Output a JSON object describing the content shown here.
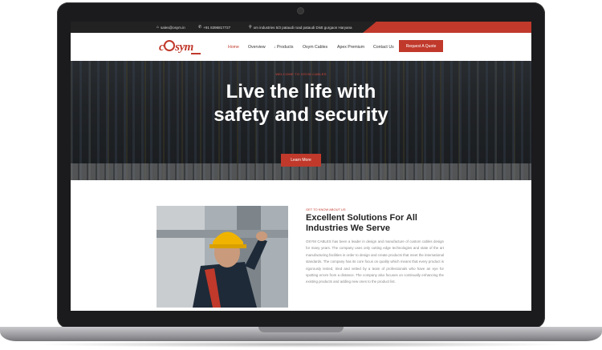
{
  "topbar": {
    "email": "sales@osym.in",
    "phone": "+91 8396817727",
    "address": "om industries 5/3 pataudi road pataudi Distt gurgaon Haryana"
  },
  "logo": {
    "text_left": "c",
    "text_right": "sym",
    "brand": "OSYM"
  },
  "nav": {
    "items": [
      {
        "label": "Home"
      },
      {
        "label": "Overview"
      },
      {
        "label": "Products"
      },
      {
        "label": "Osym Cables"
      },
      {
        "label": "Apex Premium"
      },
      {
        "label": "Contact Us"
      }
    ],
    "cta": "Request A Quote"
  },
  "hero": {
    "welcome": "WELCOME TO OSYM CABLES",
    "title_line1": "Live the life with",
    "title_line2": "safety and security",
    "button": "Learn More"
  },
  "about": {
    "tag": "GET TO KNOW ABOUT US",
    "title": "Excellent Solutions For All Industries We Serve",
    "text": "OSYM CABLES has been a leader in design and manufacture of custom cables design for many years. The company uses only cutting edge technologies and state of the art manufacturing facilities in order to design and create products that meet the international standards. The company has its core focus on quality which means that every product is rigorously tested, tried and vetted by a team of professionals who have an eye for spotting errors from a distance. The company also focuses on continually enhancing the existing products and adding new ones to the product list."
  },
  "colors": {
    "accent": "#c0392b",
    "topbar": "#222222"
  }
}
